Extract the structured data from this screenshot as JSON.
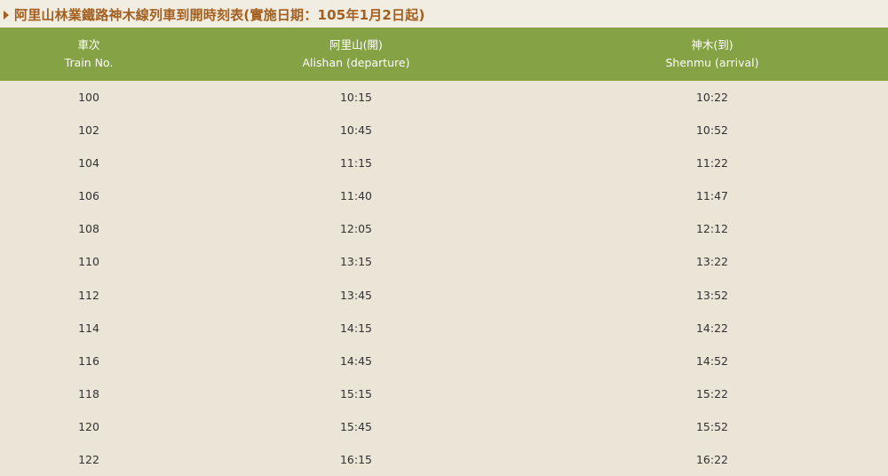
{
  "title": "阿里山林業鐵路神木線列車到開時刻表(實施日期：105年1月2日起)",
  "icons": {
    "title_marker": "triangle-right-icon"
  },
  "colors": {
    "title_text": "#a35f1d",
    "header_bg": "#85a244",
    "page_bg": "#ebe5d8"
  },
  "table": {
    "headers": [
      {
        "zh": "車次",
        "en": "Train No."
      },
      {
        "zh": "阿里山(開)",
        "en": "Alishan (departure)"
      },
      {
        "zh": "神木(到)",
        "en": "Shenmu (arrival)"
      }
    ],
    "rows": [
      [
        "100",
        "10:15",
        "10:22"
      ],
      [
        "102",
        "10:45",
        "10:52"
      ],
      [
        "104",
        "11:15",
        "11:22"
      ],
      [
        "106",
        "11:40",
        "11:47"
      ],
      [
        "108",
        "12:05",
        "12:12"
      ],
      [
        "110",
        "13:15",
        "13:22"
      ],
      [
        "112",
        "13:45",
        "13:52"
      ],
      [
        "114",
        "14:15",
        "14:22"
      ],
      [
        "116",
        "14:45",
        "14:52"
      ],
      [
        "118",
        "15:15",
        "15:22"
      ],
      [
        "120",
        "15:45",
        "15:52"
      ],
      [
        "122",
        "16:15",
        "16:22"
      ]
    ]
  }
}
